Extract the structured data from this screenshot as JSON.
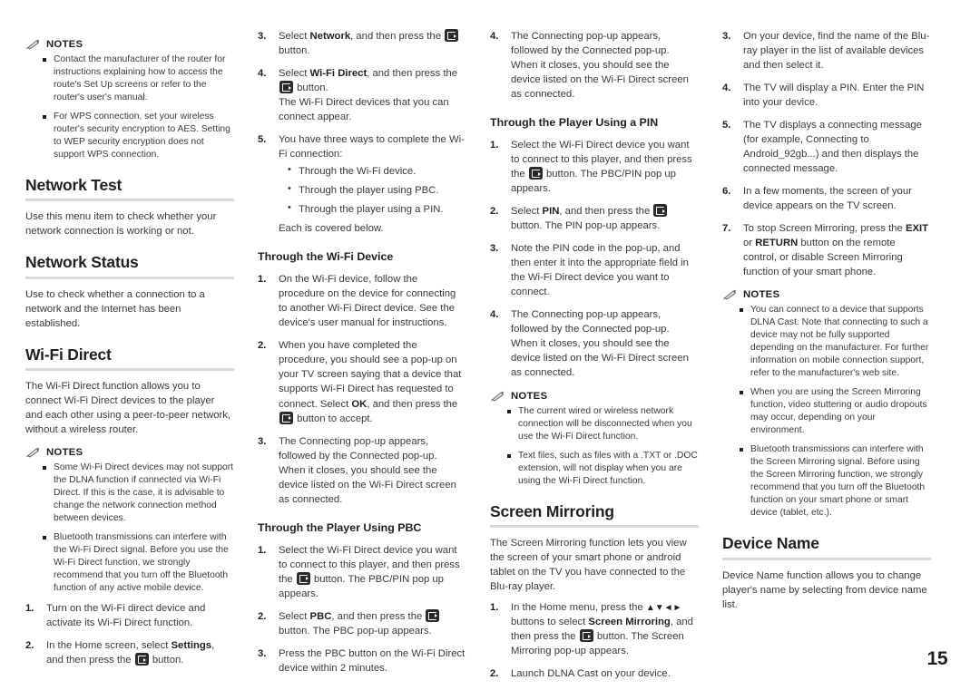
{
  "page": {
    "number": "15",
    "enter_button_icon": "enter-button-icon",
    "notes_icon": "pencil-icon"
  },
  "col1": {
    "notes1": {
      "label": "NOTES",
      "items": [
        "Contact the manufacturer of the router for instructions explaining how to access the route's Set Up screens or refer to the router's user's manual.",
        "For WPS connection, set your wireless router's security encryption to AES. Setting to WEP security encryption does not support WPS connection."
      ]
    },
    "network_test": {
      "title": "Network Test",
      "body": "Use this menu item to check whether your network connection is working or not."
    },
    "network_status": {
      "title": "Network Status",
      "body": "Use to check whether a connection to a network and the Internet has been established."
    },
    "wifi_direct": {
      "title": "Wi-Fi Direct",
      "body": "The Wi-Fi Direct function allows you to connect Wi-Fi Direct devices to the player and each other using a peer-to-peer network, without a wireless router."
    },
    "notes2": {
      "label": "NOTES",
      "items": [
        "Some Wi-Fi Direct devices may not support the DLNA function if connected via Wi-Fi Direct. If this is the case, it is advisable to change the network connection method between devices.",
        "Bluetooth transmissions can interfere with the Wi-Fi Direct signal. Before you use the Wi-Fi Direct function, we strongly recommend that you turn off the Bluetooth function of any active mobile device."
      ]
    },
    "steps": [
      {
        "num": "1.",
        "parts": [
          {
            "t": "Turn on the Wi-Fi direct device and activate its Wi-Fi Direct function."
          }
        ]
      },
      {
        "num": "2.",
        "parts": [
          {
            "t": "In the Home screen, select "
          },
          {
            "t": "Settings",
            "bold": true
          },
          {
            "t": ", and then press the "
          },
          {
            "key": true
          },
          {
            "t": " button."
          }
        ]
      }
    ]
  },
  "col2": {
    "steps_top": [
      {
        "num": "3.",
        "parts": [
          {
            "t": "Select "
          },
          {
            "t": "Network",
            "bold": true
          },
          {
            "t": ", and then press the "
          },
          {
            "key": true
          },
          {
            "t": " button."
          }
        ]
      },
      {
        "num": "4.",
        "parts": [
          {
            "t": "Select "
          },
          {
            "t": "Wi-Fi Direct",
            "bold": true
          },
          {
            "t": ", and then press the "
          },
          {
            "key": true
          },
          {
            "t": " button."
          },
          {
            "br": true
          },
          {
            "t": "The Wi-Fi Direct devices that you can connect appear."
          }
        ]
      },
      {
        "num": "5.",
        "parts": [
          {
            "t": "You have three ways to complete the Wi-Fi connection:"
          }
        ],
        "bullets": [
          "Through the Wi-Fi device.",
          "Through the player using PBC.",
          "Through the player using a PIN."
        ],
        "after": "Each is covered below."
      }
    ],
    "wifi_device": {
      "title": "Through the Wi-Fi Device",
      "steps": [
        {
          "num": "1.",
          "parts": [
            {
              "t": "On the Wi-Fi device, follow the procedure on the device for connecting to another Wi-Fi Direct device. See the device's user manual for instructions."
            }
          ]
        },
        {
          "num": "2.",
          "parts": [
            {
              "t": "When you have completed the procedure, you should see a pop-up on your TV screen saying that a device that supports Wi-Fi Direct has requested to connect. Select "
            },
            {
              "t": "OK",
              "bold": true
            },
            {
              "t": ", and then press the "
            },
            {
              "key": true
            },
            {
              "t": " button to accept."
            }
          ]
        },
        {
          "num": "3.",
          "parts": [
            {
              "t": "The Connecting pop-up appears, followed by the Connected pop-up. When it closes, you should see the device listed on the Wi-Fi Direct screen as connected."
            }
          ]
        }
      ]
    },
    "pbc": {
      "title": "Through the Player Using PBC",
      "steps": [
        {
          "num": "1.",
          "parts": [
            {
              "t": "Select the Wi-Fi Direct device you want to connect to this player, and then press the "
            },
            {
              "key": true
            },
            {
              "t": " button. The PBC/PIN pop up appears."
            }
          ]
        },
        {
          "num": "2.",
          "parts": [
            {
              "t": "Select "
            },
            {
              "t": "PBC",
              "bold": true
            },
            {
              "t": ", and then press the "
            },
            {
              "key": true
            },
            {
              "t": " button. The PBC pop-up appears."
            }
          ]
        },
        {
          "num": "3.",
          "parts": [
            {
              "t": "Press the PBC button on the Wi-Fi Direct device within 2 minutes."
            }
          ]
        }
      ]
    }
  },
  "col3": {
    "step_top": {
      "num": "4.",
      "text": "The Connecting pop-up appears, followed by the Connected pop-up. When it closes, you should see the device listed on the Wi-Fi Direct screen as connected."
    },
    "pin": {
      "title": "Through the Player Using a PIN",
      "steps": [
        {
          "num": "1.",
          "parts": [
            {
              "t": "Select the Wi-Fi Direct device you want to connect to this player, and then press the "
            },
            {
              "key": true
            },
            {
              "t": " button. The PBC/PIN pop up appears."
            }
          ]
        },
        {
          "num": "2.",
          "parts": [
            {
              "t": "Select "
            },
            {
              "t": "PIN",
              "bold": true
            },
            {
              "t": ", and then press the "
            },
            {
              "key": true
            },
            {
              "t": " button. The PIN pop-up appears."
            }
          ]
        },
        {
          "num": "3.",
          "parts": [
            {
              "t": "Note the PIN code in the pop-up, and then enter it into the appropriate field in the Wi-Fi Direct device you want to connect."
            }
          ]
        },
        {
          "num": "4.",
          "parts": [
            {
              "t": "The Connecting pop-up appears, followed by the Connected pop-up. When it closes, you should see the device listed on the Wi-Fi Direct screen as connected."
            }
          ]
        }
      ]
    },
    "notes": {
      "label": "NOTES",
      "items": [
        "The current wired or wireless network connection will be disconnected when you use the Wi-Fi Direct function.",
        "Text files, such as files with a .TXT or .DOC extension, will not display when you are using the Wi-Fi Direct function."
      ]
    },
    "screen_mirroring": {
      "title": "Screen Mirroring",
      "body": "The Screen Mirroring function lets you view the screen of your smart phone or android tablet on the TV you have connected to the Blu-ray player.",
      "steps": [
        {
          "num": "1.",
          "parts": [
            {
              "t": "In the Home menu, press the "
            },
            {
              "arrows": "▲▼◄►"
            },
            {
              "t": " buttons to select "
            },
            {
              "t": "Screen Mirroring",
              "bold": true
            },
            {
              "t": ", and then press the "
            },
            {
              "key": true
            },
            {
              "t": " button. The Screen Mirroring pop-up appears."
            }
          ]
        },
        {
          "num": "2.",
          "parts": [
            {
              "t": "Launch DLNA Cast on your device."
            }
          ]
        }
      ]
    }
  },
  "col4": {
    "steps_top": [
      {
        "num": "3.",
        "parts": [
          {
            "t": "On your device, find the name of the Blu-ray player in the list of available devices and then select it."
          }
        ]
      },
      {
        "num": "4.",
        "parts": [
          {
            "t": "The TV will display a PIN. Enter the PIN into your device."
          }
        ]
      },
      {
        "num": "5.",
        "parts": [
          {
            "t": "The TV displays a connecting message (for example, Connecting to Android_92gb...) and then displays the connected message."
          }
        ]
      },
      {
        "num": "6.",
        "parts": [
          {
            "t": "In a few moments, the screen of your device appears on the TV screen."
          }
        ]
      },
      {
        "num": "7.",
        "parts": [
          {
            "t": "To stop Screen Mirroring, press the "
          },
          {
            "t": "EXIT",
            "bold": true
          },
          {
            "t": " or "
          },
          {
            "t": "RETURN",
            "bold": true
          },
          {
            "t": " button on the remote control, or disable Screen Mirroring function of your smart phone."
          }
        ]
      }
    ],
    "notes": {
      "label": "NOTES",
      "items": [
        "You can connect to a device that supports DLNA Cast. Note that connecting to such a device may not be fully supported depending on the manufacturer. For further information on mobile connection support, refer to the manufacturer's web site.",
        "When you are using the Screen Mirroring function, video stuttering or audio dropouts may occur, depending on your environment.",
        "Bluetooth transmissions can interfere with the Screen Mirroring signal. Before using the Screen Mirroring function, we strongly recommend that you turn off the Bluetooth function on your smart phone or smart device (tablet, etc.)."
      ]
    },
    "device_name": {
      "title": "Device Name",
      "body": "Device Name function allows you to change player's name by selecting from device name list."
    }
  }
}
